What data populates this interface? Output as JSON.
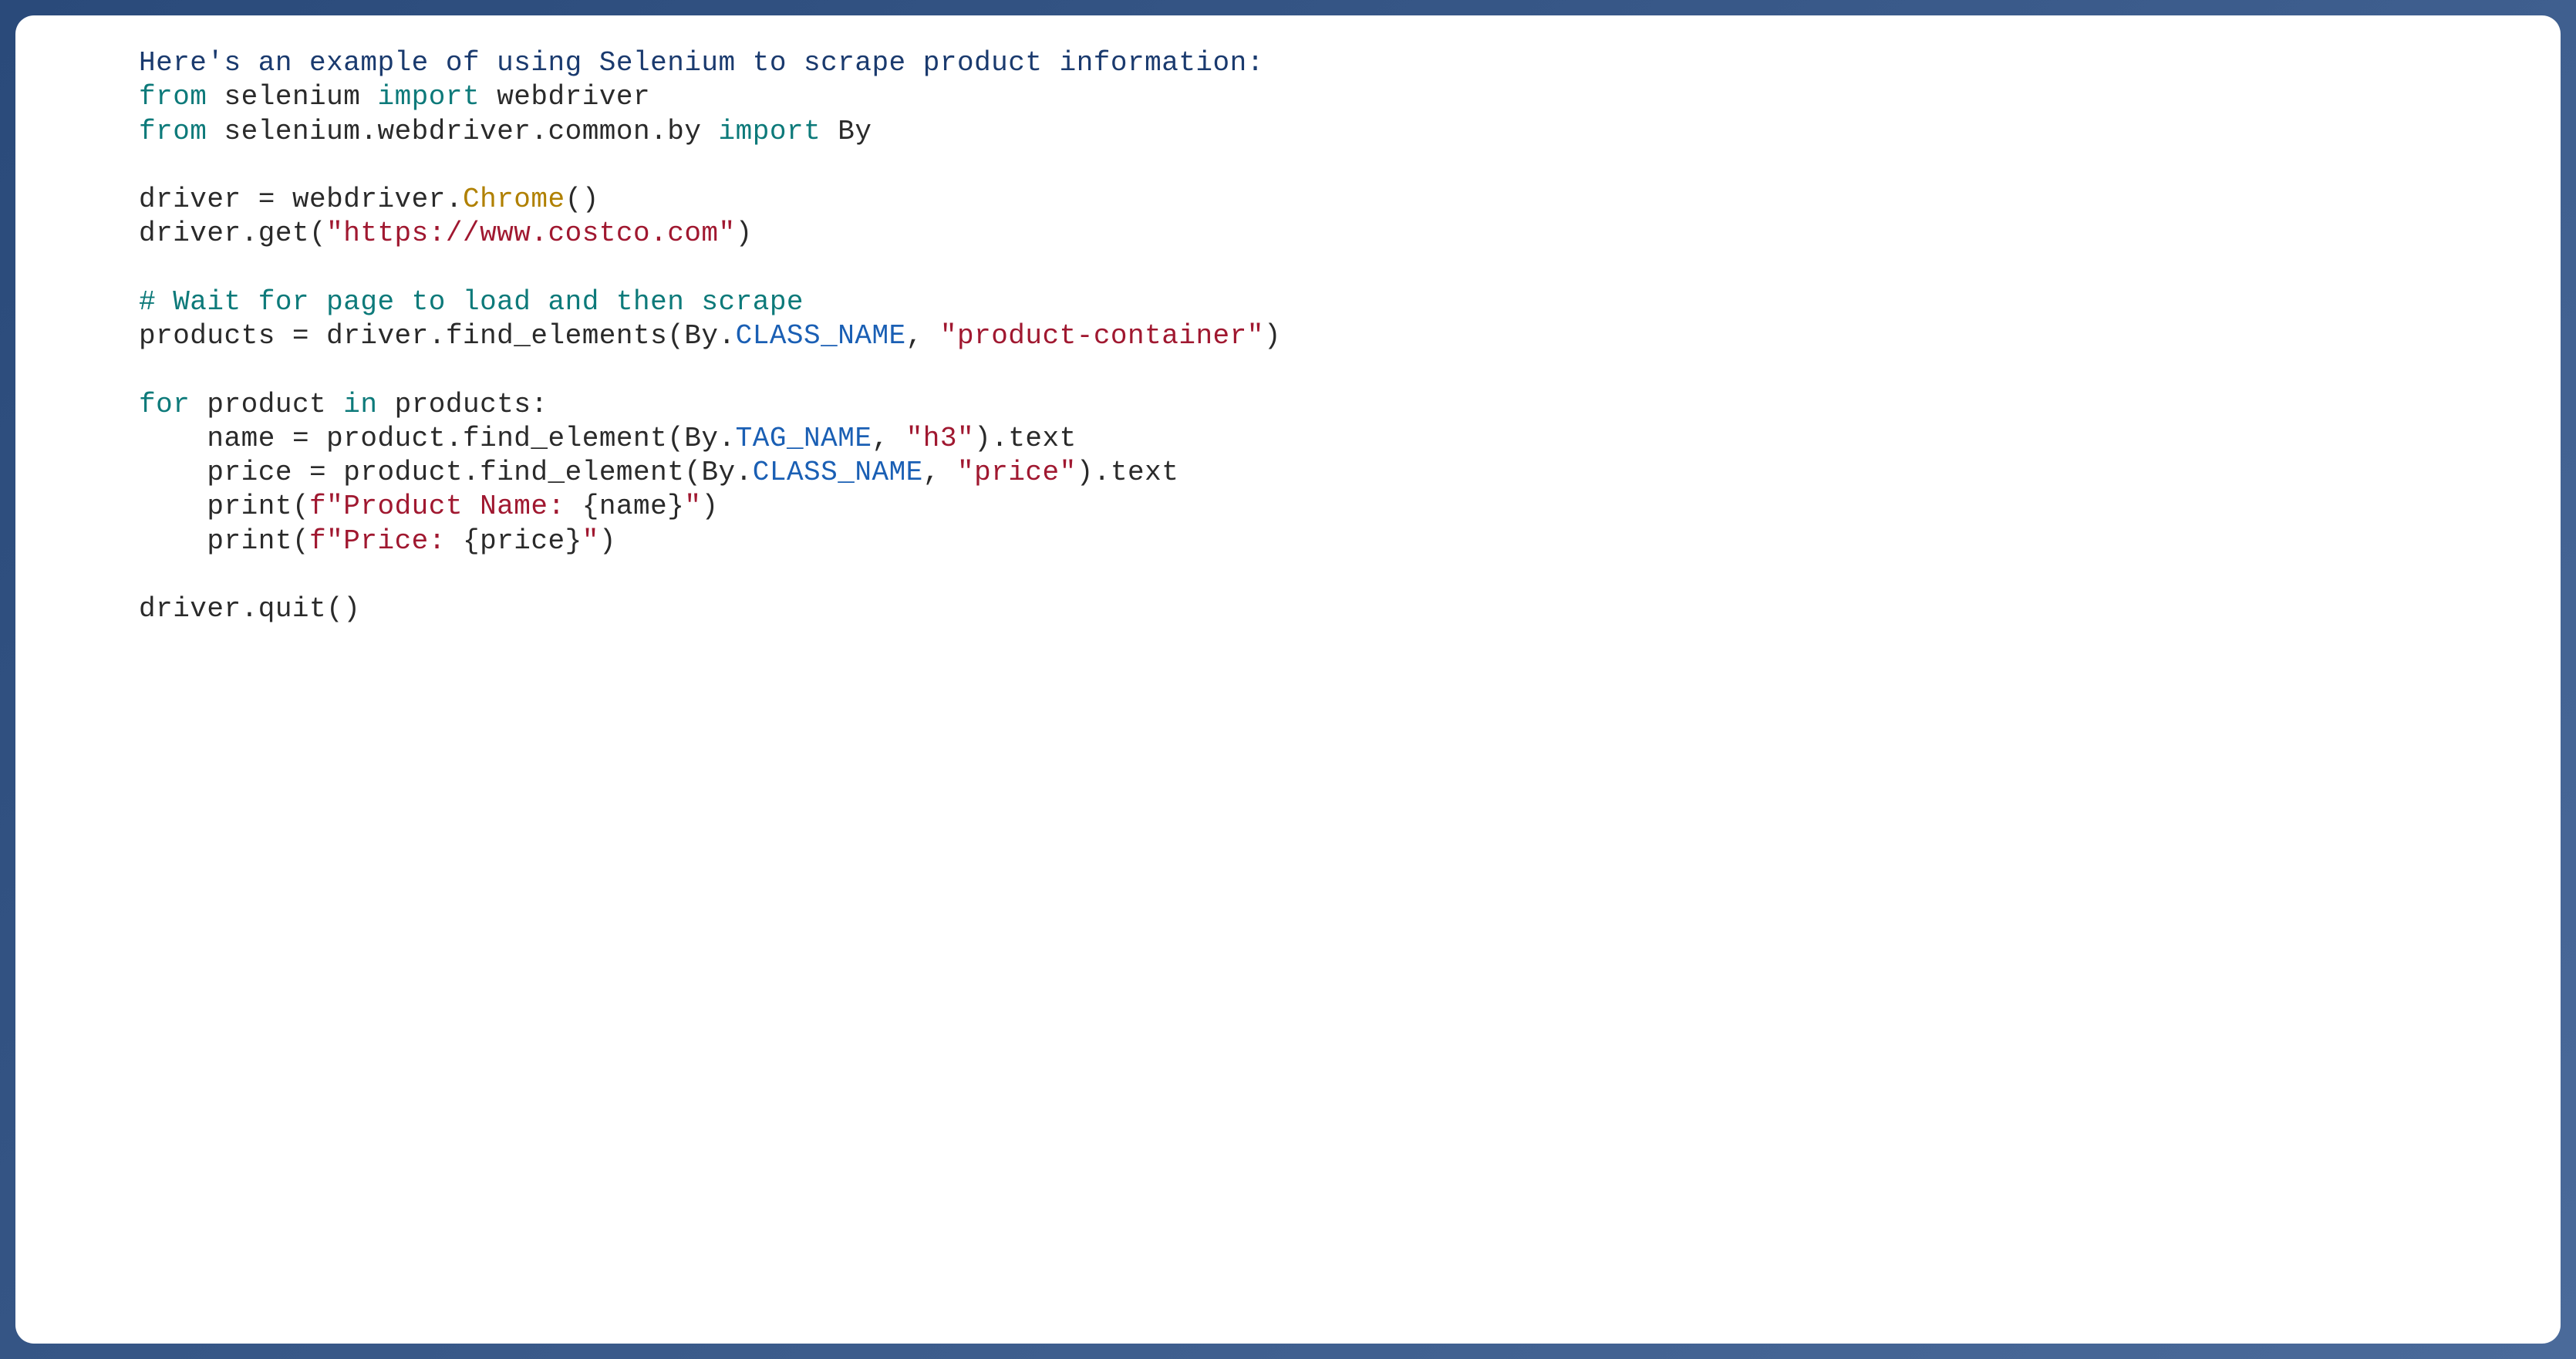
{
  "intro": "Here's an example of using Selenium to scrape product information:",
  "line1": {
    "from": "from",
    "module": "selenium",
    "import": "import",
    "target": "webdriver"
  },
  "line2": {
    "from": "from",
    "module": "selenium.webdriver.common.by",
    "import": "import",
    "target": "By"
  },
  "line3": {
    "var": "driver",
    "eq": " = ",
    "obj": "webdriver.",
    "cls": "Chrome",
    "paren": "()"
  },
  "line4": {
    "prefix": "driver.get(",
    "str": "\"https://www.costco.com\"",
    "suffix": ")"
  },
  "line5": {
    "comment": "# Wait for page to load and then scrape"
  },
  "line6": {
    "var": "products",
    "eq": " = ",
    "call": "driver.find_elements(By.",
    "const": "CLASS_NAME",
    "mid": ", ",
    "str": "\"product-container\"",
    "end": ")"
  },
  "line7": {
    "for": "for",
    "sp1": " ",
    "var": "product",
    "sp2": " ",
    "in": "in",
    "sp3": " ",
    "iter": "products:"
  },
  "line8": {
    "indent": "    ",
    "var": "name",
    "eq": " = ",
    "call": "product.find_element(By.",
    "const": "TAG_NAME",
    "mid": ", ",
    "str": "\"h3\"",
    "end": ").text"
  },
  "line9": {
    "indent": "    ",
    "var": "price",
    "eq": " = ",
    "call": "product.find_element(By.",
    "const": "CLASS_NAME",
    "mid": ", ",
    "str": "\"price\"",
    "end": ").text"
  },
  "line10": {
    "indent": "    ",
    "call": "print(",
    "f": "f",
    "str1": "\"Product Name: ",
    "brace1": "{",
    "var": "name",
    "brace2": "}",
    "str2": "\"",
    "end": ")"
  },
  "line11": {
    "indent": "    ",
    "call": "print(",
    "f": "f",
    "str1": "\"Price: ",
    "brace1": "{",
    "var": "price",
    "brace2": "}",
    "str2": "\"",
    "end": ")"
  },
  "line12": {
    "call": "driver.quit()"
  }
}
